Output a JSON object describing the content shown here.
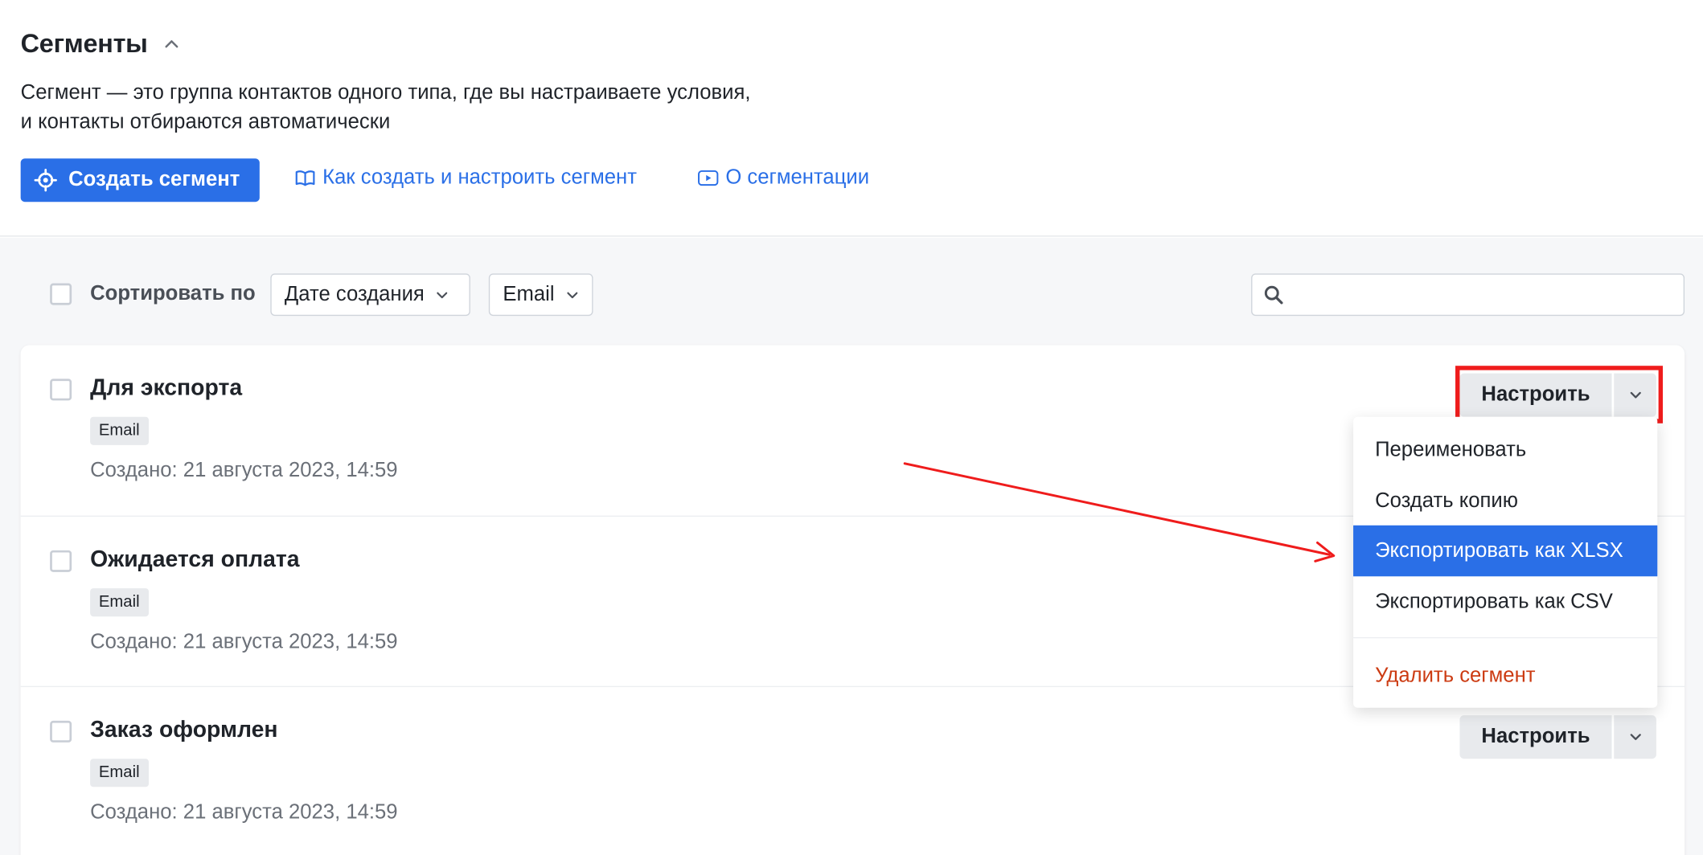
{
  "header": {
    "title": "Сегменты",
    "description_line1": "Сегмент — это группа контактов одного типа, где вы настраиваете условия,",
    "description_line2": "и контакты отбираются автоматически",
    "create_button": "Создать сегмент",
    "link_howto": "Как создать и настроить сегмент",
    "link_about": "О сегментации"
  },
  "toolbar": {
    "sort_label": "Сортировать по",
    "sort_value": "Дате создания",
    "type_value": "Email",
    "search_placeholder": ""
  },
  "segments": [
    {
      "name": "Для экспорта",
      "tag": "Email",
      "created": "Создано: 21 августа 2023, 14:59",
      "action": "Настроить"
    },
    {
      "name": "Ожидается оплата",
      "tag": "Email",
      "created": "Создано: 21 августа 2023, 14:59",
      "action": "Настроить"
    },
    {
      "name": "Заказ оформлен",
      "tag": "Email",
      "created": "Создано: 21 августа 2023, 14:59",
      "action": "Настроить"
    }
  ],
  "dropdown_menu": {
    "items": [
      {
        "label": "Переименовать"
      },
      {
        "label": "Создать копию"
      },
      {
        "label": "Экспортировать как XLSX",
        "active": true
      },
      {
        "label": "Экспортировать как CSV"
      },
      {
        "label": "Удалить сегмент",
        "danger": true
      }
    ]
  },
  "colors": {
    "primary": "#2a6fe7",
    "danger_text": "#cc3b12",
    "annotation_red": "#ef1c1c",
    "background": "#f6f7f9"
  },
  "icons": [
    "chevron-up-icon",
    "target-icon",
    "book-icon",
    "video-icon",
    "chevron-down-icon",
    "search-icon"
  ]
}
